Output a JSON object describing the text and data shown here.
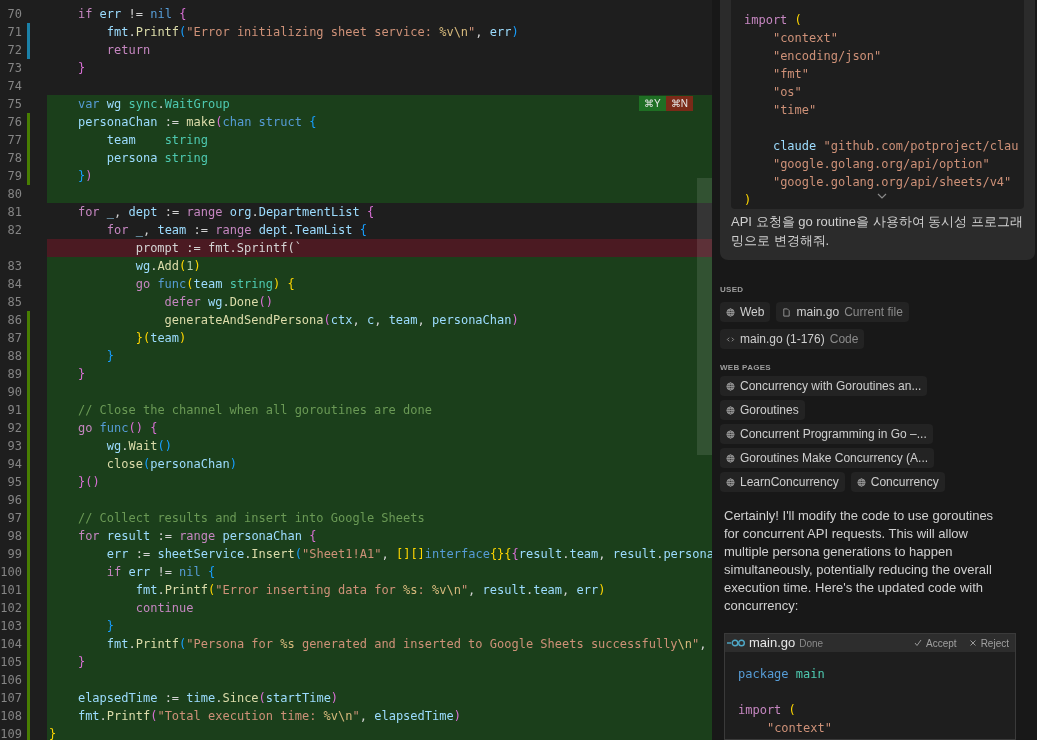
{
  "editor": {
    "lines": [
      {
        "n": "70",
        "text": "    if err != nil {",
        "added": false,
        "deleted": false,
        "modified_mark": false,
        "added_mark": false
      },
      {
        "n": "71",
        "text": "        fmt.Printf(\"Error initializing sheet service: %v\\n\", err)",
        "added": false,
        "deleted": false,
        "modified_mark": true,
        "added_mark": false
      },
      {
        "n": "72",
        "text": "        return",
        "added": false,
        "deleted": false,
        "modified_mark": true,
        "added_mark": false
      },
      {
        "n": "73",
        "text": "    }",
        "added": false,
        "deleted": false,
        "modified_mark": false,
        "added_mark": false
      },
      {
        "n": "74",
        "added": false,
        "deleted": false,
        "modified_mark": false,
        "added_mark": false
      },
      {
        "n": "75",
        "text": "    var wg sync.WaitGroup",
        "added": true,
        "deleted": false,
        "modified_mark": false,
        "added_mark": false,
        "actions": [
          {
            "label": "⌘Y",
            "kind": "accept"
          },
          {
            "label": "⌘N",
            "kind": "reject"
          }
        ]
      },
      {
        "n": "76",
        "text": "    personaChan := make(chan struct {",
        "added": true,
        "deleted": false,
        "modified_mark": false,
        "added_mark": true
      },
      {
        "n": "77",
        "text": "        team    string",
        "added": true,
        "deleted": false,
        "modified_mark": false,
        "added_mark": true
      },
      {
        "n": "78",
        "text": "        persona string",
        "added": true,
        "deleted": false,
        "modified_mark": false,
        "added_mark": true
      },
      {
        "n": "79",
        "text": "    })",
        "added": true,
        "deleted": false,
        "modified_mark": false,
        "added_mark": true
      },
      {
        "n": "80",
        "added": true,
        "deleted": false,
        "modified_mark": false,
        "added_mark": false
      },
      {
        "n": "81",
        "text": "    for _, dept := range org.DepartmentList {",
        "added": false,
        "deleted": false,
        "modified_mark": false,
        "added_mark": false
      },
      {
        "n": "82",
        "text": "        for _, team := range dept.TeamList {",
        "added": false,
        "deleted": false,
        "modified_mark": false,
        "added_mark": false
      },
      {
        "text": "            prompt := fmt.Sprintf(`",
        "added": false,
        "deleted": true,
        "modified_mark": false,
        "added_mark": false
      },
      {
        "n": "83",
        "text": "            wg.Add(1)",
        "added": true,
        "deleted": false,
        "modified_mark": false,
        "added_mark": false
      },
      {
        "n": "84",
        "text": "            go func(team string) {",
        "added": true,
        "deleted": false,
        "modified_mark": false,
        "added_mark": false
      },
      {
        "n": "85",
        "text": "                defer wg.Done()",
        "added": true,
        "deleted": false,
        "modified_mark": false,
        "added_mark": false
      },
      {
        "n": "86",
        "text": "                generateAndSendPersona(ctx, c, team, personaChan)",
        "added": true,
        "deleted": false,
        "modified_mark": false,
        "added_mark": true
      },
      {
        "n": "87",
        "text": "            }(team)",
        "added": true,
        "deleted": false,
        "modified_mark": false,
        "added_mark": true
      },
      {
        "n": "88",
        "text": "        }",
        "added": true,
        "deleted": false,
        "modified_mark": false,
        "added_mark": true
      },
      {
        "n": "89",
        "text": "    }",
        "added": true,
        "deleted": false,
        "modified_mark": false,
        "added_mark": true
      },
      {
        "n": "90",
        "added": true,
        "deleted": false,
        "modified_mark": false,
        "added_mark": true
      },
      {
        "n": "91",
        "text": "    // Close the channel when all goroutines are done",
        "added": true,
        "deleted": false,
        "modified_mark": false,
        "added_mark": true
      },
      {
        "n": "92",
        "text": "    go func() {",
        "added": true,
        "deleted": false,
        "modified_mark": false,
        "added_mark": true
      },
      {
        "n": "93",
        "text": "        wg.Wait()",
        "added": true,
        "deleted": false,
        "modified_mark": false,
        "added_mark": true
      },
      {
        "n": "94",
        "text": "        close(personaChan)",
        "added": true,
        "deleted": false,
        "modified_mark": false,
        "added_mark": true
      },
      {
        "n": "95",
        "text": "    }()",
        "added": true,
        "deleted": false,
        "modified_mark": false,
        "added_mark": true
      },
      {
        "n": "96",
        "added": true,
        "deleted": false,
        "modified_mark": false,
        "added_mark": true
      },
      {
        "n": "97",
        "text": "    // Collect results and insert into Google Sheets",
        "added": true,
        "deleted": false,
        "modified_mark": false,
        "added_mark": true
      },
      {
        "n": "98",
        "text": "    for result := range personaChan {",
        "added": true,
        "deleted": false,
        "modified_mark": false,
        "added_mark": true
      },
      {
        "n": "99",
        "text": "        err := sheetService.Insert(\"Sheet1!A1\", [][]interface{}{{result.team, result.persona",
        "added": true,
        "deleted": false,
        "modified_mark": false,
        "added_mark": true
      },
      {
        "n": "100",
        "text": "        if err != nil {",
        "added": true,
        "deleted": false,
        "modified_mark": false,
        "added_mark": true
      },
      {
        "n": "101",
        "text": "            fmt.Printf(\"Error inserting data for %s: %v\\n\", result.team, err)",
        "added": true,
        "deleted": false,
        "modified_mark": false,
        "added_mark": true
      },
      {
        "n": "102",
        "text": "            continue",
        "added": true,
        "deleted": false,
        "modified_mark": false,
        "added_mark": true
      },
      {
        "n": "103",
        "text": "        }",
        "added": true,
        "deleted": false,
        "modified_mark": false,
        "added_mark": true
      },
      {
        "n": "104",
        "text": "        fmt.Printf(\"Persona for %s generated and inserted to Google Sheets successfully\\n\",",
        "added": true,
        "deleted": false,
        "modified_mark": false,
        "added_mark": true
      },
      {
        "n": "105",
        "text": "    }",
        "added": true,
        "deleted": false,
        "modified_mark": false,
        "added_mark": true
      },
      {
        "n": "106",
        "added": true,
        "deleted": false,
        "modified_mark": false,
        "added_mark": true
      },
      {
        "n": "107",
        "text": "    elapsedTime := time.Since(startTime)",
        "added": true,
        "deleted": false,
        "modified_mark": false,
        "added_mark": true
      },
      {
        "n": "108",
        "text": "    fmt.Printf(\"Total execution time: %v\\n\", elapsedTime)",
        "added": true,
        "deleted": false,
        "modified_mark": false,
        "added_mark": true
      },
      {
        "n": "109",
        "text": "}",
        "added": true,
        "deleted": false,
        "modified_mark": false,
        "added_mark": true
      }
    ]
  },
  "chat": {
    "prompt": {
      "code_lines": [
        [
          "import (",
          "    \"context\"",
          "    \"encoding/json\"",
          "    \"fmt\"",
          "    \"os\"",
          "    \"time\""
        ],
        [
          "    claude \"github.com/potproject/clau",
          "    \"google.golang.org/api/option\"",
          "    \"google.golang.org/api/sheets/v4\"",
          ")"
        ]
      ],
      "message": "API 요청을 go routine을 사용하여 동시성 프로그래밍으로 변경해줘."
    },
    "used_label": "USED",
    "used": [
      {
        "kind": "web",
        "label": "Web"
      },
      {
        "kind": "file",
        "label": "main.go",
        "detail": "Current file"
      },
      {
        "kind": "code",
        "label": "main.go (1-176)",
        "detail": "Code"
      }
    ],
    "web_label": "WEB PAGES",
    "web_pages": [
      "Concurrency with Goroutines an...",
      "Goroutines",
      "Concurrent Programming in Go –...",
      "Goroutines Make Concurrency (A...",
      "LearnConcurrency",
      "Concurrency"
    ],
    "response": "Certainly! I'll modify the code to use goroutines for concurrent API requests. This will allow multiple persona generations to happen simultaneously, potentially reducing the overall execution time. Here's the updated code with concurrency:",
    "code_block": {
      "file": "main.go",
      "status": "Done",
      "actions": [
        {
          "label": "Accept",
          "kind": "accept"
        },
        {
          "label": "Reject",
          "kind": "reject"
        }
      ],
      "lines": [
        [
          "package main"
        ],
        [
          "import (",
          "    \"context\""
        ]
      ]
    }
  }
}
